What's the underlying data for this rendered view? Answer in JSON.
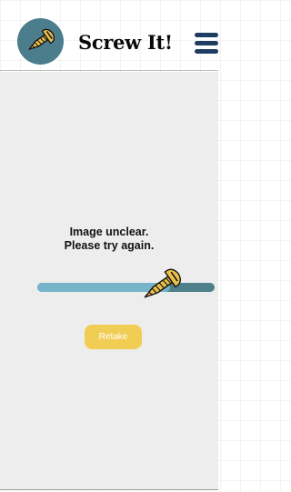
{
  "header": {
    "title": "Screw It!",
    "logo_icon": "screw-icon",
    "menu_icon": "hamburger-menu-icon"
  },
  "status": {
    "line1": "Image unclear.",
    "line2": "Please try again."
  },
  "progress": {
    "value": 0.75,
    "thumb_icon": "screw-icon"
  },
  "actions": {
    "retake_label": "Retake"
  },
  "colors": {
    "logo_circle": "#4b7d8c",
    "menu_bars": "#1f3d63",
    "track_fill": "#78b4c9",
    "track_rest": "#4f7f8a",
    "button": "#f2cd53",
    "screw": "#e9c04a"
  }
}
